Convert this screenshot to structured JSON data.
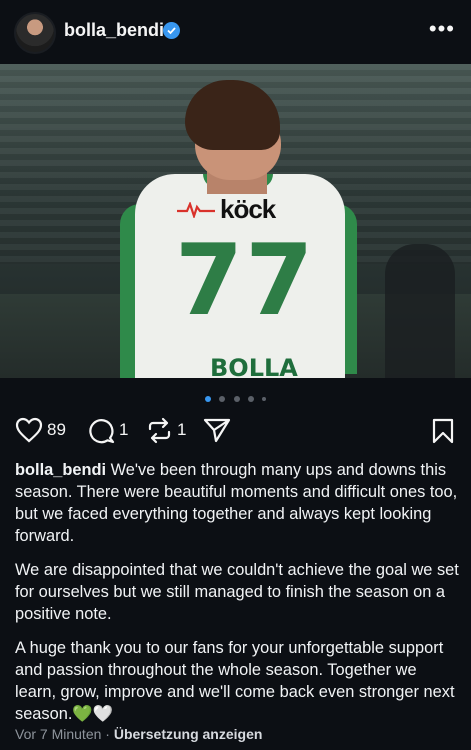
{
  "header": {
    "username": "bolla_bendi",
    "verified_icon": "verified-badge-icon",
    "more_icon": "more-dots-icon",
    "more_label": "•••"
  },
  "photo": {
    "sponsor": "köck",
    "shirt_number": "77",
    "shirt_name": "BOLLA",
    "carousel_count": 5,
    "carousel_active": 1
  },
  "actions": {
    "likes": "89",
    "comments": "1",
    "reposts": "1"
  },
  "caption": {
    "username": "bolla_bendi",
    "paragraph1": " We've been through many ups and downs this season. There were beautiful moments and difficult ones too, but we faced everything together and always kept looking forward.",
    "paragraph2": "We are disappointed that we couldn't achieve the goal we set for ourselves but we still managed to finish the season on a positive note.",
    "paragraph3": "A huge thank you to our fans for your unforgettable support and passion throughout the whole season. Together we learn, grow, improve and we'll come back even stronger next season.💚🤍"
  },
  "meta": {
    "time": "Vor 7 Minuten",
    "separator": " · ",
    "translate": "Übersetzung anzeigen"
  },
  "colors": {
    "background": "#0c0f14",
    "accent": "#3897f0",
    "jersey_green": "#2e7d46"
  }
}
